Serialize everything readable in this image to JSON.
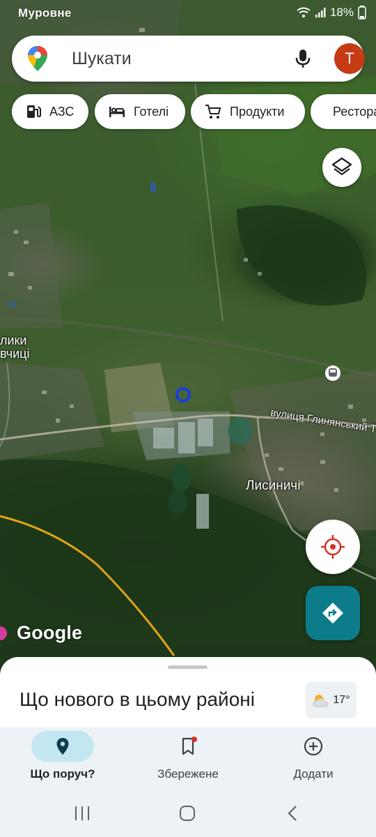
{
  "status_bar": {
    "carrier": "Mypoвне",
    "battery": "18%"
  },
  "search": {
    "placeholder": "Шукати",
    "avatar_letter": "T"
  },
  "chips": [
    {
      "label": "АЗС",
      "icon": "gas-station-icon"
    },
    {
      "label": "Готелі",
      "icon": "bed-icon"
    },
    {
      "label": "Продукти",
      "icon": "cart-icon"
    },
    {
      "label": "Ресторани",
      "icon": "restaurant-icon"
    }
  ],
  "map": {
    "labels": {
      "left_village_1": "лики",
      "left_village_2": "вчиці",
      "street": "вулиця Глинянський Т",
      "village": "Лисиничі"
    },
    "logo": "Google"
  },
  "sheet": {
    "title": "Що нового в цьому районі",
    "weather_temp": "17°"
  },
  "bottom_nav": [
    {
      "label": "Що поруч?",
      "icon": "location-pin-icon",
      "active": true
    },
    {
      "label": "Збережене",
      "icon": "bookmark-icon",
      "active": false
    },
    {
      "label": "Додати",
      "icon": "add-circle-icon",
      "active": false
    }
  ],
  "colors": {
    "accent": "#0d7c8a",
    "avatar": "#c53b15",
    "location_dot": "#1a3de0"
  }
}
